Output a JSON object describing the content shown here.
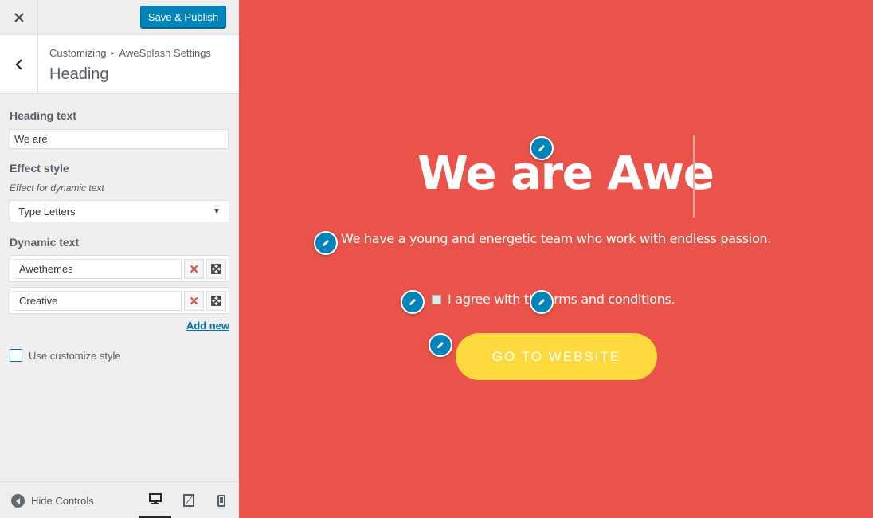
{
  "topbar": {
    "close_icon": "close-icon",
    "publish_label": "Save & Publish"
  },
  "section": {
    "breadcrumb_root": "Customizing",
    "breadcrumb_current": "AweSplash Settings",
    "title": "Heading"
  },
  "controls": {
    "heading_text_label": "Heading text",
    "heading_text_value": "We are",
    "effect_style_label": "Effect style",
    "effect_style_desc": "Effect for dynamic text",
    "effect_style_value": "Type Letters",
    "dynamic_text_label": "Dynamic text",
    "dynamic_items": [
      "Awethemes",
      "Creative"
    ],
    "add_new_label": "Add new",
    "use_customize_style_label": "Use customize style"
  },
  "footer": {
    "hide_controls_label": "Hide Controls",
    "devices": [
      "desktop",
      "tablet",
      "mobile"
    ],
    "active_device": "desktop"
  },
  "preview": {
    "background_color": "#e9534a",
    "heading": "We are Awe",
    "subtitle": "We have a young and energetic team who work with endless passion.",
    "agree_text_before": "I agree with th",
    "agree_text_after": "erms and conditions.",
    "cta_label": "GO TO WEBSITE",
    "cta_color": "#fdd93d"
  },
  "colors": {
    "accent": "#0085ba",
    "link": "#0073aa"
  }
}
